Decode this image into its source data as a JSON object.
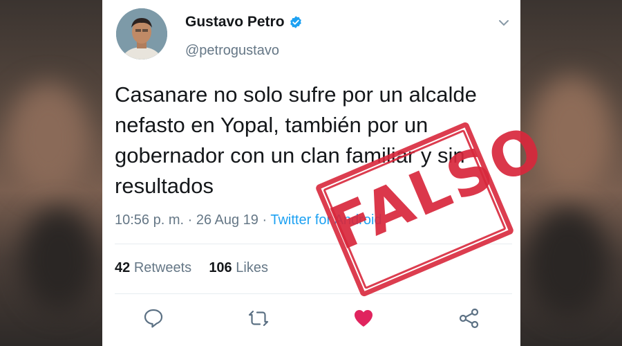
{
  "tweet": {
    "display_name": "Gustavo Petro",
    "handle": "@petrogustavo",
    "text": "Casanare no solo sufre por un alcalde nefasto en Yopal, también por un gobernador con un clan familiar y sin resultados",
    "time": "10:56 p. m. · 26 Aug 19 · ",
    "source": "Twitter for Android",
    "retweets_count": "42",
    "retweets_label": "Retweets",
    "likes_count": "106",
    "likes_label": "Likes"
  },
  "stamp": {
    "label": "FALSO"
  },
  "icons": [
    "verified-badge-icon",
    "chevron-down-icon",
    "reply-icon",
    "retweet-icon",
    "like-icon",
    "share-icon"
  ],
  "colors": {
    "accent": "#1da1f2",
    "like": "#e0245e",
    "stamp": "#d8283c",
    "text": "#14171a",
    "muted": "#657786"
  }
}
